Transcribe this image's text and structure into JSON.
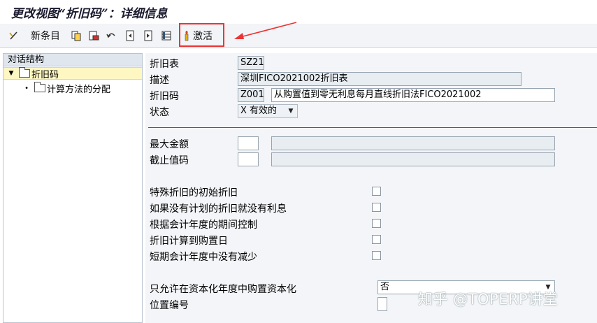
{
  "window": {
    "title": "更改视图“折旧码”：详细信息"
  },
  "toolbar": {
    "new_entries_label": "新条目",
    "activate_label": "激活"
  },
  "tree": {
    "header": "对话结构",
    "items": [
      {
        "label": "折旧码",
        "selected": true
      },
      {
        "label": "计算方法的分配",
        "selected": false
      }
    ]
  },
  "form": {
    "depr_table": {
      "label": "折旧表",
      "value": "SZ21"
    },
    "description": {
      "label": "描述",
      "value": "深圳FICO2021002折旧表"
    },
    "depr_key": {
      "label": "折旧码",
      "code": "Z001",
      "text": "从购置值到零无利息每月直线折旧法FICO2021002"
    },
    "status": {
      "label": "状态",
      "value": "X 有效的"
    },
    "max_amount": {
      "label": "最大金额",
      "value": ""
    },
    "cutoff_value_key": {
      "label": "截止值码",
      "value": ""
    },
    "checkboxes": [
      {
        "label": "特殊折旧的初始折旧",
        "checked": false
      },
      {
        "label": "如果没有计划的折旧就没有利息",
        "checked": false
      },
      {
        "label": "根据会计年度的期间控制",
        "checked": false
      },
      {
        "label": "折旧计算到购置日",
        "checked": false
      },
      {
        "label": "短期会计年度中没有减少",
        "checked": false
      }
    ],
    "acq_only_in_cap_year": {
      "label": "只允许在资本化年度中购置资本化",
      "value": "否"
    },
    "position_number": {
      "label": "位置编号",
      "value": ""
    }
  },
  "watermark": "知乎 @TOPERP讲堂",
  "colors": {
    "highlight_box": "#e33333",
    "tree_selected": "#fff7c2"
  }
}
